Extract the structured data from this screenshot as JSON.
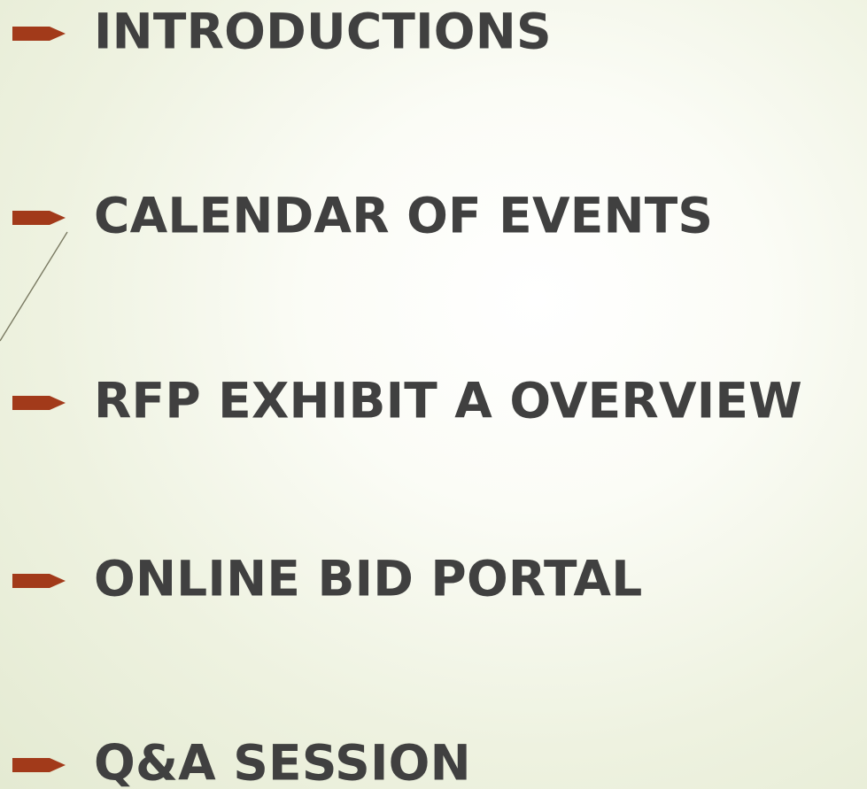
{
  "slide": {
    "accent_color": "#a23a1a",
    "text_color": "#404040",
    "bullet_icon": "arrow-bullet-icon",
    "items": [
      {
        "label": "INTRODUCTIONS"
      },
      {
        "label": "CALENDAR OF EVENTS"
      },
      {
        "label": "RFP EXHIBIT A OVERVIEW"
      },
      {
        "label": "ONLINE BID PORTAL"
      },
      {
        "label": "Q&A SESSION"
      }
    ]
  }
}
